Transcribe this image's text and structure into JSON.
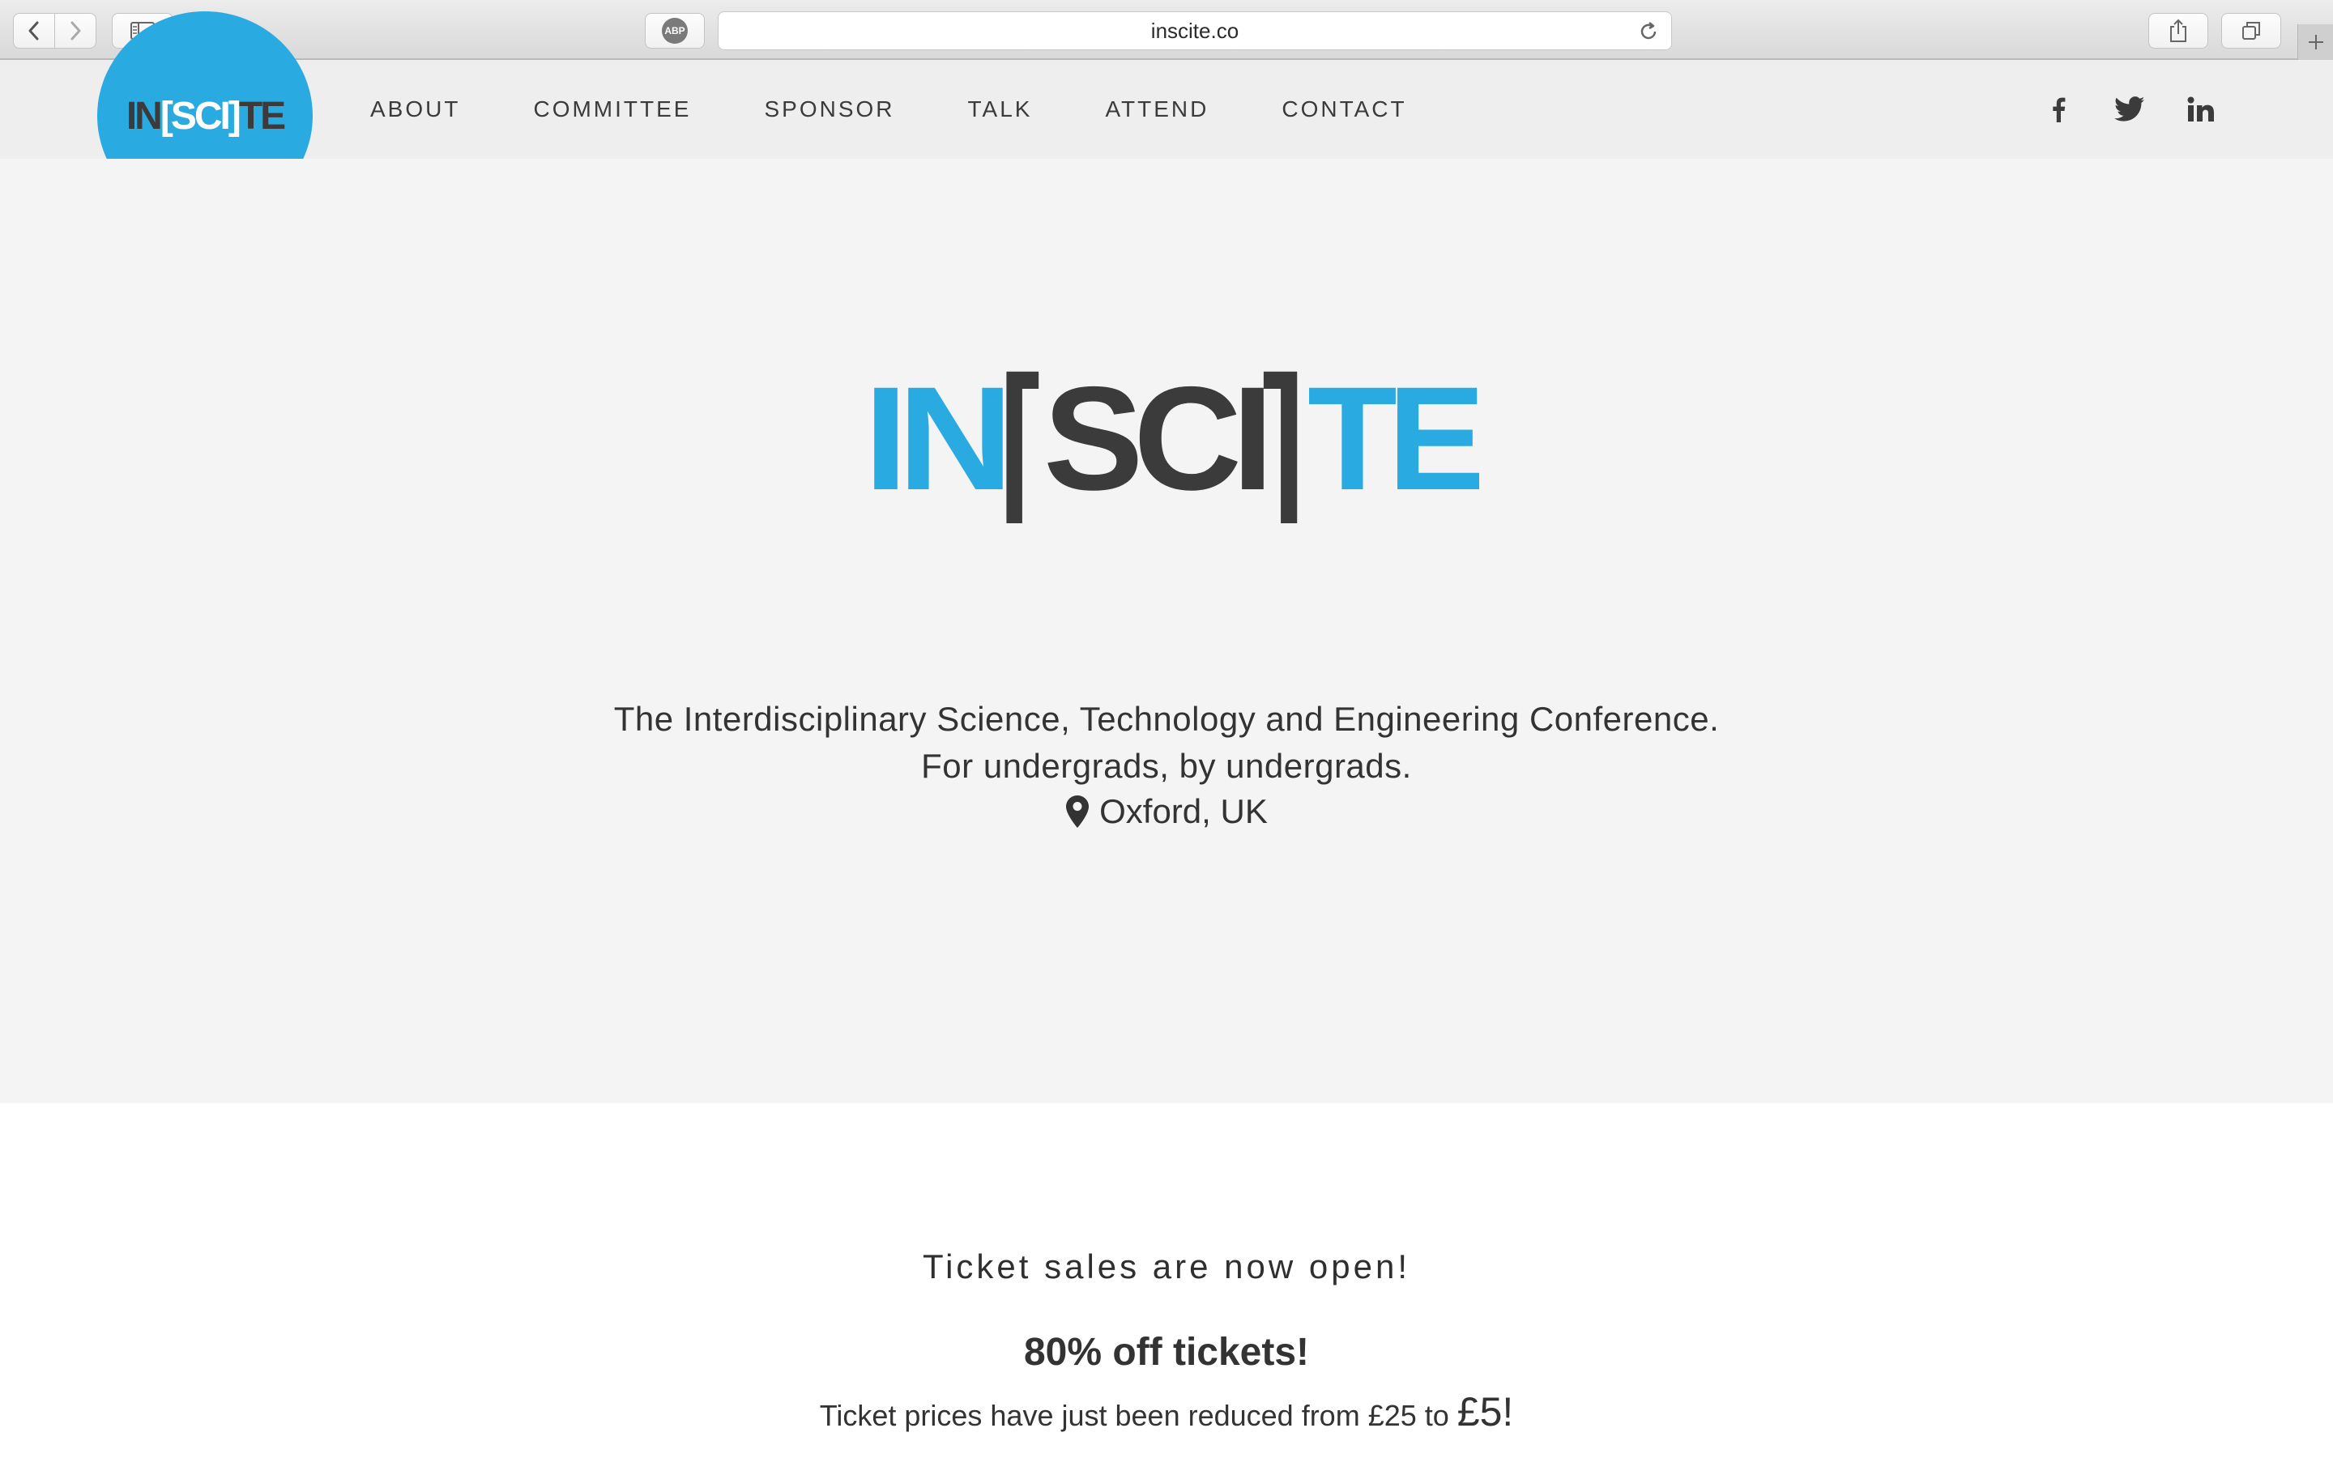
{
  "browser": {
    "url": "inscite.co",
    "adblock_badge": "ABP"
  },
  "site": {
    "logo": {
      "part1": "IN",
      "part2": "[SCI]",
      "part3": "TE"
    },
    "nav": [
      {
        "label": "ABOUT"
      },
      {
        "label": "COMMITTEE"
      },
      {
        "label": "SPONSOR"
      },
      {
        "label": "TALK"
      },
      {
        "label": "ATTEND"
      },
      {
        "label": "CONTACT"
      }
    ],
    "social": [
      "facebook-icon",
      "twitter-icon",
      "linkedin-icon"
    ]
  },
  "hero": {
    "logo": {
      "part1": "IN",
      "bracket_open": "[",
      "part2": "SCI",
      "bracket_close": "]",
      "part3": "TE"
    },
    "tagline_1": "The Interdisciplinary Science, Technology and Engineering Conference.",
    "tagline_2": "For undergrads, by undergrads.",
    "location": "Oxford, UK"
  },
  "tickets": {
    "heading": "Ticket sales are now open!",
    "discount": "80% off tickets!",
    "prices_prefix": "Ticket prices have just been reduced from £25 to ",
    "new_price": "£5!"
  },
  "colors": {
    "brand_blue": "#29abe2",
    "brand_dark": "#3b3b3b",
    "hero_bg": "#f4f4f4",
    "nav_bg": "#eeeeee"
  }
}
